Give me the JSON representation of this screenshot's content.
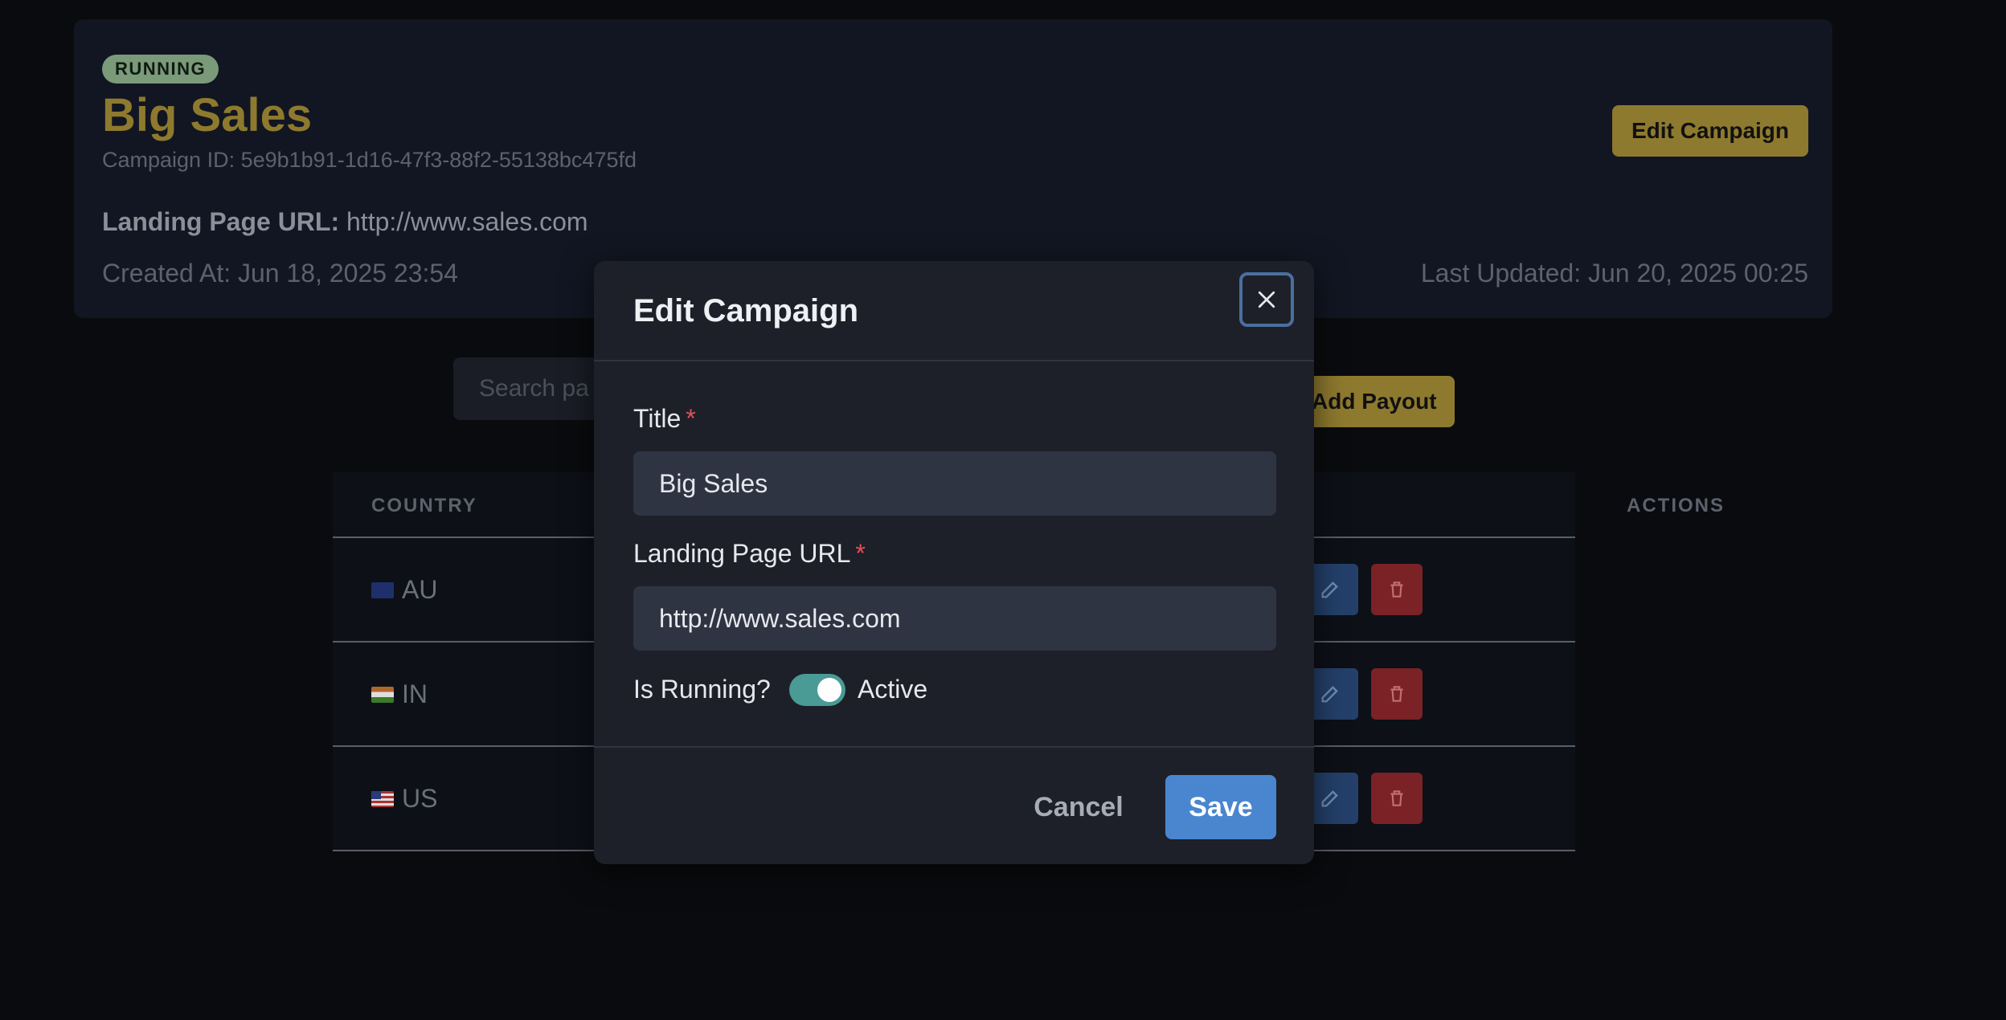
{
  "campaign": {
    "status_badge": "RUNNING",
    "title": "Big Sales",
    "id_text": "Campaign ID: 5e9b1b91-1d16-47f3-88f2-55138bc475fd",
    "landing_label": "Landing Page URL:",
    "landing_url": "http://www.sales.com",
    "created_at": "Created At: Jun 18, 2025 23:54",
    "updated_at": "Last Updated: Jun 20, 2025 00:25",
    "edit_button": "Edit Campaign"
  },
  "payouts": {
    "search_placeholder": "Search pa",
    "add_button": "Add Payout",
    "columns": {
      "country": "COUNTRY",
      "actions": "ACTIONS"
    },
    "rows": [
      {
        "country": "AU",
        "flag": "au-flag-icon"
      },
      {
        "country": "IN",
        "flag": "in-flag-icon"
      },
      {
        "country": "US",
        "flag": "us-flag-icon"
      }
    ]
  },
  "modal": {
    "title": "Edit Campaign",
    "title_label": "Title",
    "title_value": "Big Sales",
    "url_label": "Landing Page URL",
    "url_value": "http://www.sales.com",
    "required_mark": "*",
    "running_label": "Is Running?",
    "running_state": "Active",
    "running_on": true,
    "cancel_label": "Cancel",
    "save_label": "Save"
  },
  "colors": {
    "accent_gold": "#8e7a2e",
    "primary_blue": "#4a86cf",
    "danger_red": "#7a2226",
    "toggle_teal": "#4a9a96"
  }
}
